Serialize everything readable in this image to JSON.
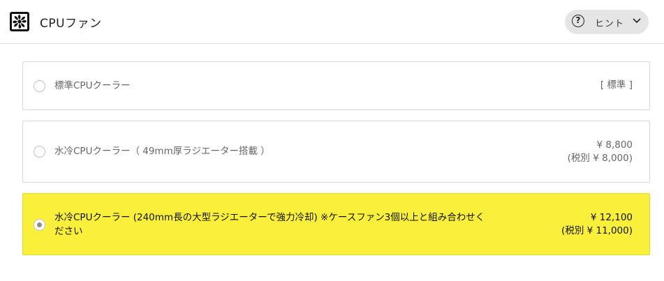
{
  "header": {
    "title": "CPUファン",
    "logo_icon": "fan-icon",
    "hint_label": "ヒント"
  },
  "options": [
    {
      "label": "標準CPUクーラー",
      "price": "[ 標準 ]",
      "tax_note": "",
      "selected": false
    },
    {
      "label": "水冷CPUクーラー（ 49mm厚ラジエーター搭載 ）",
      "price": "¥ 8,800",
      "tax_note": "(税別 ¥ 8,000)",
      "selected": false
    },
    {
      "label_line1": "水冷CPUクーラー (240mm長の大型ラジエーターで強力冷却) ※ケースファン3個以上と組み合わせく",
      "label_line2": "ださい",
      "price": "¥ 12,100",
      "tax_note": "(税別 ¥ 11,000)",
      "selected": true
    }
  ],
  "colors": {
    "selected_bg": "#faf03c",
    "hint_bg": "#e5e5e5"
  }
}
